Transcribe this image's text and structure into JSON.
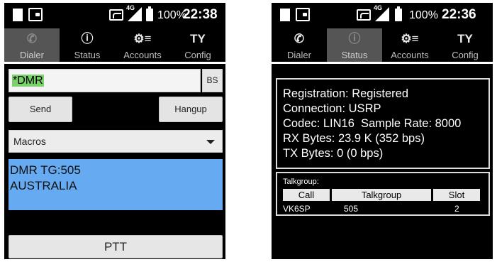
{
  "left_phone": {
    "statusbar": {
      "network": "4G",
      "battery": "100%",
      "time": "22:38"
    },
    "tabs": [
      {
        "label": "Dialer",
        "icon": "phone-icon",
        "active": true
      },
      {
        "label": "Status",
        "icon": "info-icon",
        "active": false
      },
      {
        "label": "Accounts",
        "icon": "accounts-icon",
        "active": false
      },
      {
        "label": "Config",
        "icon": "config-icon",
        "active": false
      }
    ],
    "dial_value": "*DMR",
    "bs_label": "BS",
    "send_label": "Send",
    "hangup_label": "Hangup",
    "macros_label": "Macros",
    "info_lines": [
      "DMR TG:505",
      "AUSTRALIA"
    ],
    "ptt_label": "PTT"
  },
  "right_phone": {
    "statusbar": {
      "network": "4G",
      "battery": "100%",
      "time": "22:36"
    },
    "tabs": [
      {
        "label": "Dialer",
        "icon": "phone-icon",
        "active": false
      },
      {
        "label": "Status",
        "icon": "info-icon",
        "active": true
      },
      {
        "label": "Accounts",
        "icon": "accounts-icon",
        "active": false
      },
      {
        "label": "Config",
        "icon": "config-icon",
        "active": false
      }
    ],
    "status_lines": [
      "Registration: Registered",
      "Connection: USRP",
      "Codec: LIN16  Sample Rate: 8000",
      "RX Bytes: 23.9 K (352 bps)",
      "TX Bytes: 0 (0 bps)"
    ],
    "talkgroup": {
      "title": "Talkgroup:",
      "headers": [
        "Call",
        "Talkgroup",
        "Slot"
      ],
      "row": [
        "VK6SP",
        "505",
        "2"
      ]
    }
  },
  "colors": {
    "background": "#000000",
    "active_tab": "#555555",
    "dial_highlight": "#7bd16b",
    "info_box": "#66aaf2"
  }
}
